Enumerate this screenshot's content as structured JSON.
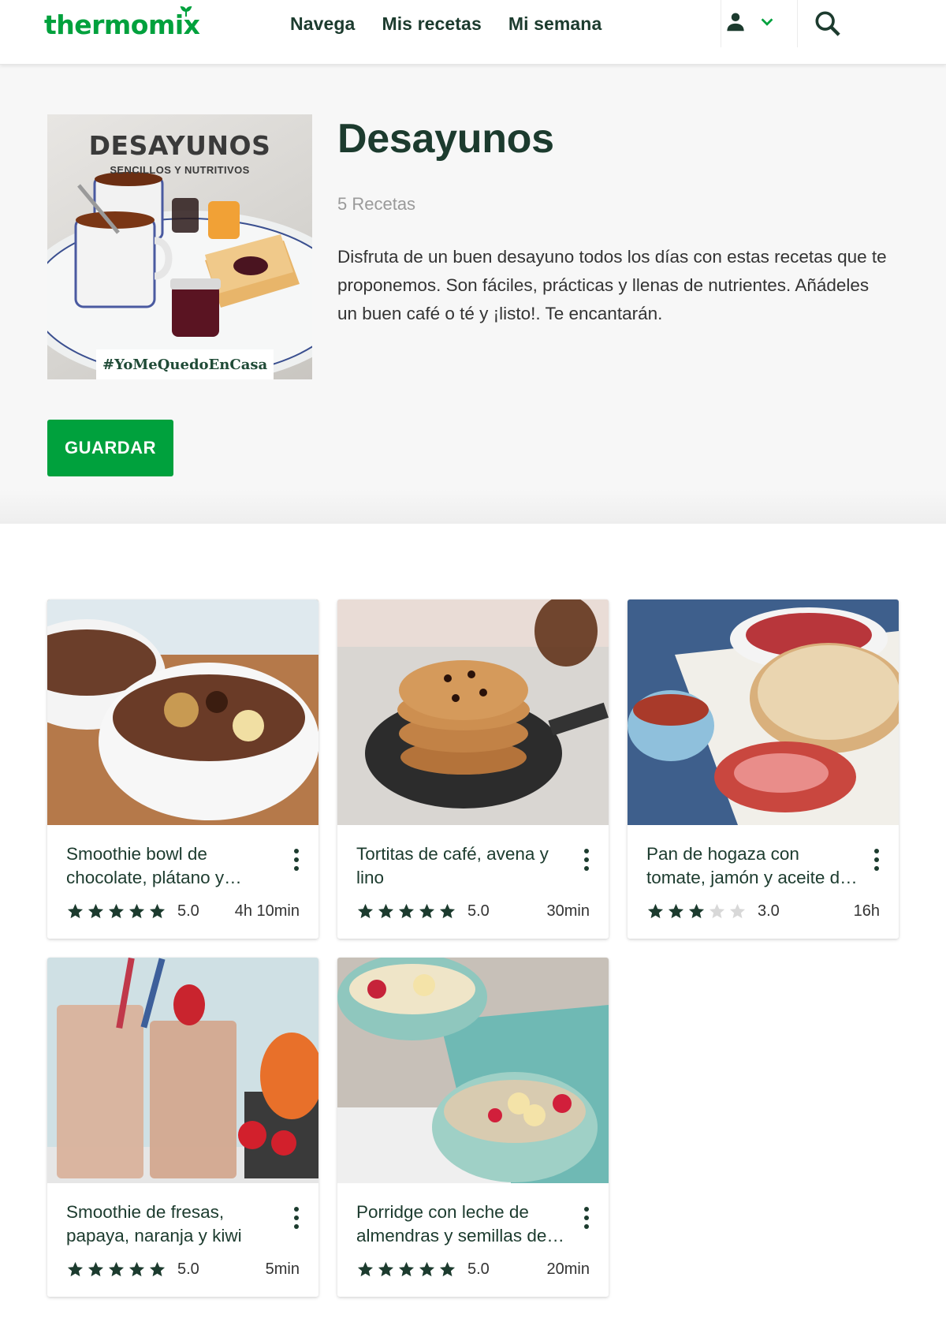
{
  "header": {
    "logo": "thermomix",
    "nav": [
      "Navega",
      "Mis recetas",
      "Mi semana"
    ],
    "icons": {
      "user": "user-icon",
      "dropdown": "chevron-down-icon",
      "search": "search-icon"
    }
  },
  "collection": {
    "cover": {
      "title": "DESAYUNOS",
      "subtitle": "SENCILLOS Y NUTRITIVOS",
      "tag": "#YoMeQuedoEnCasa"
    },
    "title": "Desayunos",
    "count": "5 Recetas",
    "description": "Disfruta de un buen desayuno todos los días con estas recetas que te proponemos. Son fáciles, prácticas y llenas de nutrientes. Añádeles un buen café o té y ¡listo!. Te encantarán.",
    "save_label": "GUARDAR"
  },
  "colors": {
    "brand": "#00a13d",
    "text": "#1c3b2e",
    "hero_bg": "#f7f7f7"
  },
  "recipes": [
    {
      "title": "Smoothie bowl de chocolate, plátano y cacahuete",
      "rating": "5.0",
      "stars": 5,
      "time": "4h 10min"
    },
    {
      "title": "Tortitas de café, avena y lino",
      "rating": "5.0",
      "stars": 5,
      "time": "30min"
    },
    {
      "title": "Pan de hogaza con tomate, jamón y aceite de oliva",
      "rating": "3.0",
      "stars": 3,
      "time": "16h"
    },
    {
      "title": "Smoothie de fresas, papaya, naranja y kiwi",
      "rating": "5.0",
      "stars": 5,
      "time": "5min"
    },
    {
      "title": "Porridge con leche de almendras y semillas de chía",
      "rating": "5.0",
      "stars": 5,
      "time": "20min"
    }
  ]
}
